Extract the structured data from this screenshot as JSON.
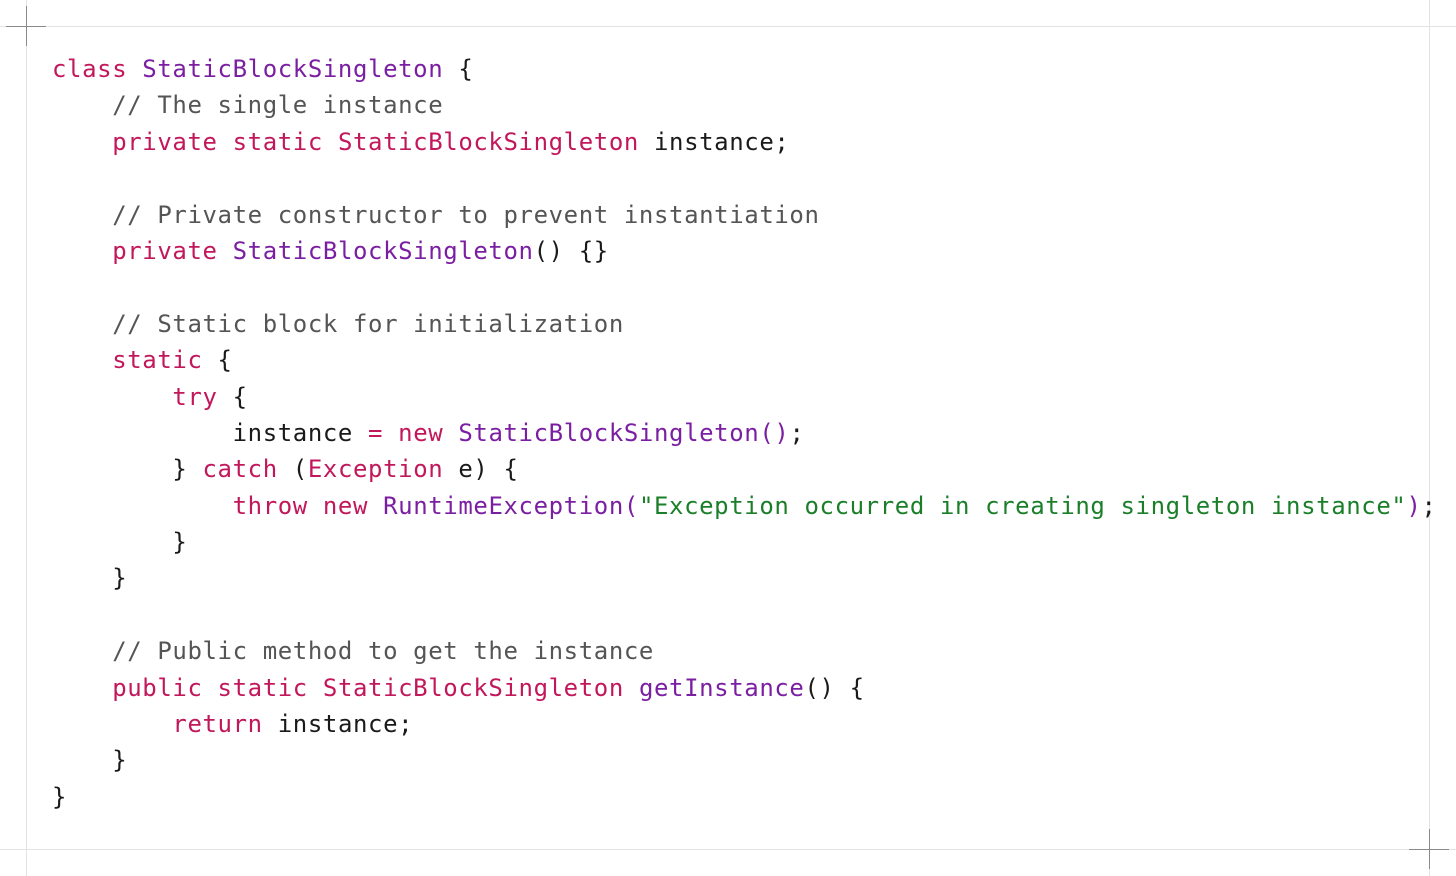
{
  "code": {
    "language": "java",
    "lines": [
      [
        {
          "t": "class ",
          "k": "kw"
        },
        {
          "t": "StaticBlockSingleton",
          "k": "ty"
        },
        {
          "t": " {",
          "k": "pn"
        }
      ],
      [
        {
          "t": "    // The single instance",
          "k": "cm"
        }
      ],
      [
        {
          "t": "    private static ",
          "k": "kw"
        },
        {
          "t": "StaticBlockSingleton",
          "k": "ty2"
        },
        {
          "t": " instance;",
          "k": "pn"
        }
      ],
      [],
      [
        {
          "t": "    // Private constructor to prevent instantiation",
          "k": "cm"
        }
      ],
      [
        {
          "t": "    private ",
          "k": "kw"
        },
        {
          "t": "StaticBlockSingleton",
          "k": "ty"
        },
        {
          "t": "() {}",
          "k": "pn"
        }
      ],
      [],
      [
        {
          "t": "    // Static block for initialization",
          "k": "cm"
        }
      ],
      [
        {
          "t": "    static",
          "k": "kw"
        },
        {
          "t": " {",
          "k": "pn"
        }
      ],
      [
        {
          "t": "        try",
          "k": "kw"
        },
        {
          "t": " {",
          "k": "pn"
        }
      ],
      [
        {
          "t": "            instance ",
          "k": "pn"
        },
        {
          "t": "= new ",
          "k": "kw"
        },
        {
          "t": "StaticBlockSingleton()",
          "k": "ty"
        },
        {
          "t": ";",
          "k": "pn"
        }
      ],
      [
        {
          "t": "        } ",
          "k": "pn"
        },
        {
          "t": "catch",
          "k": "kw"
        },
        {
          "t": " (",
          "k": "pn"
        },
        {
          "t": "Exception",
          "k": "ty2"
        },
        {
          "t": " e) {",
          "k": "pn"
        }
      ],
      [
        {
          "t": "            throw new ",
          "k": "kw"
        },
        {
          "t": "RuntimeException(",
          "k": "ty"
        },
        {
          "t": "\"Exception occurred in creating singleton instance\"",
          "k": "st"
        },
        {
          "t": ")",
          "k": "ty"
        },
        {
          "t": ";",
          "k": "pn"
        }
      ],
      [
        {
          "t": "        }",
          "k": "pn"
        }
      ],
      [
        {
          "t": "    }",
          "k": "pn"
        }
      ],
      [],
      [
        {
          "t": "    // Public method to get the instance",
          "k": "cm"
        }
      ],
      [
        {
          "t": "    public static ",
          "k": "kw"
        },
        {
          "t": "StaticBlockSingleton",
          "k": "ty2"
        },
        {
          "t": " ",
          "k": "pn"
        },
        {
          "t": "getInstance",
          "k": "ty"
        },
        {
          "t": "() {",
          "k": "pn"
        }
      ],
      [
        {
          "t": "        return",
          "k": "kw"
        },
        {
          "t": " instance;",
          "k": "pn"
        }
      ],
      [
        {
          "t": "    }",
          "k": "pn"
        }
      ],
      [
        {
          "t": "}",
          "k": "pn"
        }
      ]
    ]
  },
  "colors": {
    "keyword": "#c2185b",
    "type": "#7b1fa2",
    "comment": "#555555",
    "string": "#1b7f2a",
    "plain": "#1a1a1a",
    "background": "#ffffff"
  }
}
